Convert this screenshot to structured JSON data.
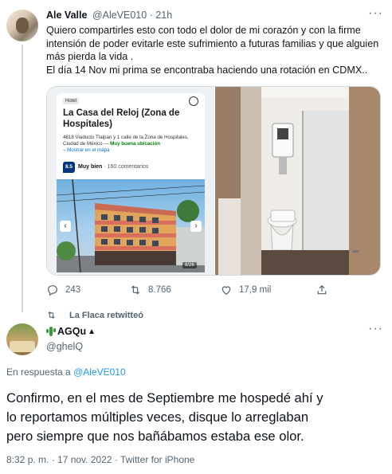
{
  "tweet": {
    "author_name": "Ale Valle",
    "handle": "@AleVE010",
    "time": "21h",
    "text_lines": [
      "Quiero compartirles esto con todo el dolor de mi corazón y con la firme",
      "intensión de poder evitarle este sufrimiento a futuras familias y que alguien",
      "más pierda la vida .",
      "El día 14 Nov mi prima se encontraba haciendo una rotación en CDMX.."
    ],
    "card": {
      "badge": "Hotel",
      "title": "La Casa del Reloj (Zona de Hospitales)",
      "address": "4818 Viaducto Tlalpan y 1 calle de la Zona de Hospitales, Ciudad de México —",
      "location_rating": "Muy buena ubicación",
      "map_link": "– Mostrar en el mapa",
      "score": "8.5",
      "score_label": "Muy bien",
      "reviews": "· 160 comentarios",
      "photo_counter": "8/26"
    },
    "actions": {
      "replies": "243",
      "retweets": "8.766",
      "likes": "17,9 mil"
    }
  },
  "retweet_notice": "La Flaca retwitteó",
  "quoted": {
    "display_name": "AGQu",
    "handle": "@ghelQ",
    "reply_to_prefix": "En respuesta a ",
    "reply_to_handle": "@AleVE010",
    "body_lines": [
      "Confirmo, en el mes de Septiembre me hospedé ahí y",
      "lo reportamos múltiples veces, disque lo arreglaban",
      "pero siempre que nos bañábamos estaba ese olor."
    ],
    "meta": "8:32 p. m. · 17 nov. 2022 · Twitter for iPhone"
  },
  "colors": {
    "accent": "#1d9bf0",
    "muted": "#536471",
    "text": "#0f1419",
    "badge_bg": "#003580"
  },
  "icons": [
    "more-icon",
    "reply-icon",
    "retweet-icon",
    "like-icon",
    "share-icon",
    "bookmark-icon",
    "chevron-left-icon",
    "chevron-right-icon",
    "cactus-emoji-icon"
  ]
}
